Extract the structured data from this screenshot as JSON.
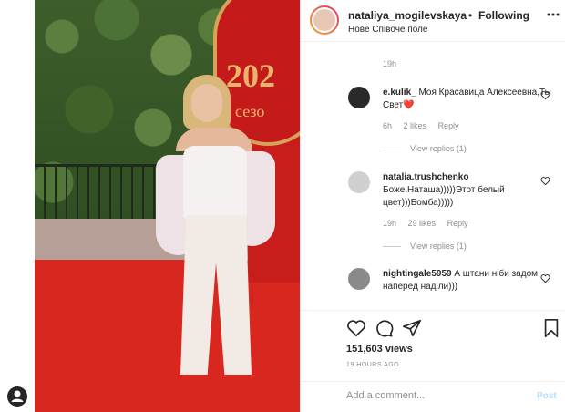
{
  "header": {
    "username": "nataliya_mogilevskaya",
    "separator": "•",
    "follow_status": "Following",
    "location": "Нове Співоче поле",
    "more_icon": "more-horizontal-icon"
  },
  "media": {
    "logo_text": "202",
    "logo_sub": "сезо"
  },
  "comments": {
    "prev_time": "19h",
    "items": [
      {
        "username": "e.kulik_",
        "text": "Моя Красавица Алексеевна,Ты Свет❤️",
        "time": "6h",
        "likes": "2 likes",
        "reply": "Reply",
        "view_replies": "View replies (1)"
      },
      {
        "username": "natalia.trushchenko",
        "text": "Боже,Наташа)))))Этот белый цвет)))Бомба)))))",
        "time": "19h",
        "likes": "29 likes",
        "reply": "Reply",
        "view_replies": "View replies (1)"
      },
      {
        "username": "nightingale5959",
        "text": "А штани ніби задом наперед наділи)))"
      }
    ]
  },
  "actions": {
    "views": "151,603 views",
    "posted": "19 HOURS AGO"
  },
  "add_comment": {
    "placeholder": "Add a comment...",
    "post_label": "Post"
  },
  "colors": {
    "accent": "#0095f6",
    "post_disabled": "#b2dffc",
    "muted": "#8e8e8e"
  }
}
